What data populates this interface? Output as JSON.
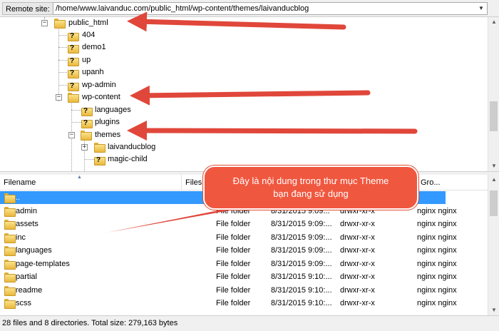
{
  "site_bar": {
    "label": "Remote site:",
    "path": "/home/www.laivanduc.com/public_html/wp-content/themes/laivanducblog",
    "dropdown_glyph": "▼"
  },
  "tree": {
    "items": [
      {
        "label": "public_html",
        "icon": "folder-icon",
        "expander": "−"
      },
      {
        "label": "404",
        "icon": "unknown-folder-icon"
      },
      {
        "label": "demo1",
        "icon": "unknown-folder-icon"
      },
      {
        "label": "up",
        "icon": "unknown-folder-icon"
      },
      {
        "label": "upanh",
        "icon": "unknown-folder-icon"
      },
      {
        "label": "wp-admin",
        "icon": "unknown-folder-icon"
      },
      {
        "label": "wp-content",
        "icon": "folder-icon",
        "expander": "−"
      },
      {
        "label": "languages",
        "icon": "unknown-folder-icon"
      },
      {
        "label": "plugins",
        "icon": "unknown-folder-icon"
      },
      {
        "label": "themes",
        "icon": "folder-icon",
        "expander": "−"
      },
      {
        "label": "laivanducblog",
        "icon": "folder-icon",
        "expander": "+"
      },
      {
        "label": "magic-child",
        "icon": "unknown-folder-icon"
      }
    ],
    "question_mark": "?"
  },
  "list": {
    "headers": [
      "Filename",
      "Filesiz",
      "",
      "",
      "",
      "Gro..."
    ],
    "sort_glyph": "▲",
    "rows": [
      {
        "name": "..",
        "size": "",
        "type": "",
        "modified": "",
        "perms": "",
        "owner": "",
        "selected": true
      },
      {
        "name": "admin",
        "size": "",
        "type": "File folder",
        "modified": "8/31/2015 9:09...",
        "perms": "drwxr-xr-x",
        "owner": "nginx nginx"
      },
      {
        "name": "assets",
        "size": "",
        "type": "File folder",
        "modified": "8/31/2015 9:09:...",
        "perms": "drwxr-xr-x",
        "owner": "nginx nginx"
      },
      {
        "name": "inc",
        "size": "",
        "type": "File folder",
        "modified": "8/31/2015 9:09:...",
        "perms": "drwxr-xr-x",
        "owner": "nginx nginx"
      },
      {
        "name": "languages",
        "size": "",
        "type": "File folder",
        "modified": "8/31/2015 9:09:...",
        "perms": "drwxr-xr-x",
        "owner": "nginx nginx"
      },
      {
        "name": "page-templates",
        "size": "",
        "type": "File folder",
        "modified": "8/31/2015 9:09:...",
        "perms": "drwxr-xr-x",
        "owner": "nginx nginx"
      },
      {
        "name": "partial",
        "size": "",
        "type": "File folder",
        "modified": "8/31/2015 9:10:...",
        "perms": "drwxr-xr-x",
        "owner": "nginx nginx"
      },
      {
        "name": "readme",
        "size": "",
        "type": "File folder",
        "modified": "8/31/2015 9:10:...",
        "perms": "drwxr-xr-x",
        "owner": "nginx nginx"
      },
      {
        "name": "scss",
        "size": "",
        "type": "File folder",
        "modified": "8/31/2015 9:10:...",
        "perms": "drwxr-xr-x",
        "owner": "nginx nginx"
      }
    ]
  },
  "status_bar": {
    "text": "28 files and 8 directories. Total size: 279,163 bytes"
  },
  "annotation": {
    "callout_line1": "Đây là nội dung trong thư mục Theme",
    "callout_line2": "bạn đang sử dụng",
    "arrow_color": "#e0473a"
  }
}
